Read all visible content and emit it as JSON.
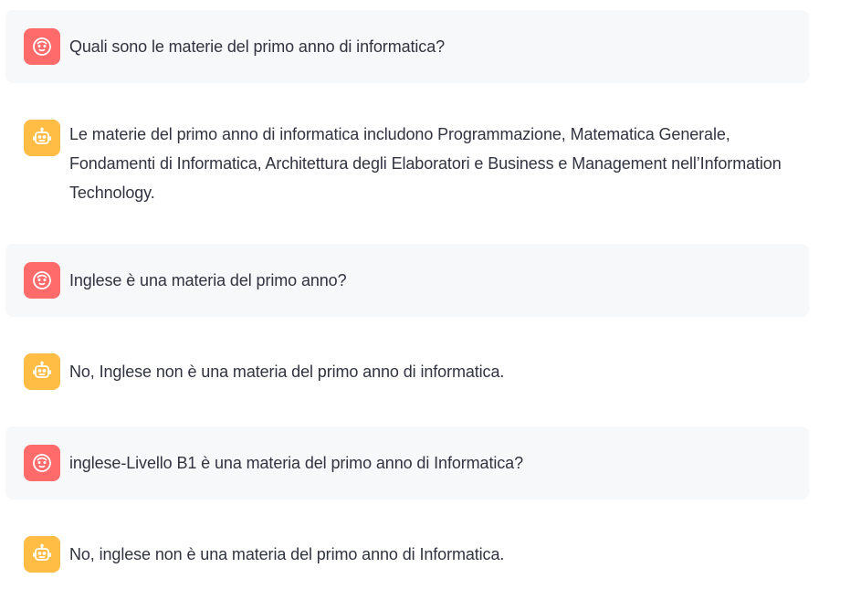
{
  "messages": [
    {
      "role": "user",
      "avatar_icon": "smiley-face-icon",
      "text": "Quali sono le materie del primo anno di informatica?"
    },
    {
      "role": "assistant",
      "avatar_icon": "robot-icon",
      "text": "Le materie del primo anno di informatica includono Programmazione, Matematica Generale, Fondamenti di Informatica, Architettura degli Elaboratori e Business e Management nell’Information Technology."
    },
    {
      "role": "user",
      "avatar_icon": "smiley-face-icon",
      "text": "Inglese è una materia del primo anno?"
    },
    {
      "role": "assistant",
      "avatar_icon": "robot-icon",
      "text": "No, Inglese non è una materia del primo anno di informatica."
    },
    {
      "role": "user",
      "avatar_icon": "smiley-face-icon",
      "text": "inglese-Livello B1 è una materia del primo anno di Informatica?"
    },
    {
      "role": "assistant",
      "avatar_icon": "robot-icon",
      "text": "No, inglese non è una materia del primo anno di Informatica."
    }
  ],
  "colors": {
    "user_avatar": "#ff6b6b",
    "assistant_avatar": "#ffbd45",
    "user_bubble": "#f7f8fa",
    "text": "#31333f"
  }
}
